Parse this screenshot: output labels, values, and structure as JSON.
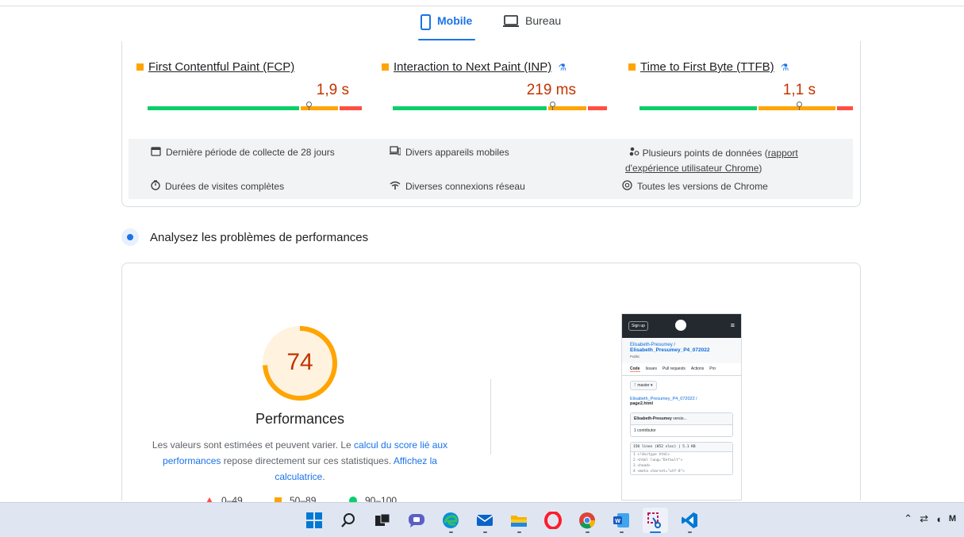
{
  "tabs": {
    "mobile": "Mobile",
    "desktop": "Bureau",
    "active": "mobile"
  },
  "metrics": [
    {
      "label": "First Contentful Paint (FCP)",
      "value": "1,9 s",
      "status": "orange",
      "experimental": false,
      "marker_fraction": 0.73
    },
    {
      "label": "Interaction to Next Paint (INP)",
      "value": "219 ms",
      "status": "orange",
      "experimental": true,
      "marker_fraction": 0.74
    },
    {
      "label": "Time to First Byte (TTFB)",
      "value": "1,1 s",
      "status": "orange",
      "experimental": true,
      "marker_fraction": 0.74
    }
  ],
  "collection_info": {
    "period": "Dernière période de collecte de 28 jours",
    "devices": "Divers appareils mobiles",
    "datapoints_prefix": "Plusieurs points de données (",
    "datapoints_link_part1": "rapport",
    "datapoints_link_part2": "d'expérience utilisateur Chrome",
    "datapoints_suffix": ")",
    "durations": "Durées de visites complètes",
    "network": "Diverses connexions réseau",
    "chrome": "Toutes les versions de Chrome"
  },
  "section": {
    "title": "Analysez les problèmes de performances"
  },
  "performance": {
    "score": "74",
    "score_value": 74,
    "title": "Performances",
    "desc_part1": "Les valeurs sont estimées et peuvent varier. Le ",
    "desc_link1": "calcul du score lié aux performances",
    "desc_part2": " repose directement sur ces statistiques. ",
    "desc_link2": "Affichez la calculatrice",
    "desc_part3": ".",
    "legend": [
      {
        "range": "0–49",
        "shape": "triangle"
      },
      {
        "range": "50–89",
        "shape": "square"
      },
      {
        "range": "90–100",
        "shape": "circle"
      }
    ]
  },
  "thumbnail": {
    "signup": "Sign up",
    "owner": "Elisabeth-Presumey /",
    "repo": "Elisabeth_Presumey_P4_072022",
    "visibility": "Public",
    "nav": [
      "Code",
      "Issues",
      "Pull requests",
      "Actions",
      "Pro"
    ],
    "branch": "master",
    "path_repo": "Elisabeth_Presumey_P4_072022",
    "path_file": "page2.html",
    "commit_author": "Elisabeth-Presumey",
    "commit_msg": "versio...",
    "contributors": "1 contributor",
    "code_header": "150 lines (852 sloc) | 5.1 KB",
    "code_lines": [
      "1  <!doctype html>",
      "2  <html lang=\"Default\">",
      "3  <head>",
      "4    <meta charset=\"utf-8\">"
    ]
  },
  "colors": {
    "accent": "#1a73e8",
    "good": "#0cce6b",
    "average": "#ffa400",
    "poor": "#ff4e42",
    "score_text": "#c33300"
  },
  "taskbar": {
    "apps": [
      "windows-start-icon",
      "search-icon",
      "task-view-icon",
      "chat-icon",
      "edge-icon",
      "mail-icon",
      "file-explorer-icon",
      "opera-icon",
      "chrome-icon",
      "word-icon",
      "snipping-tool-icon",
      "vscode-icon"
    ]
  }
}
